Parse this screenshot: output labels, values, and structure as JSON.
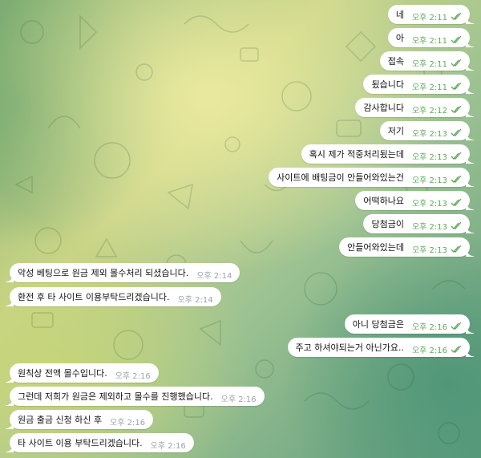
{
  "colors": {
    "incoming_bg": "#ffffff",
    "outgoing_bg": "#ffffff",
    "outgoing_time": "#5fa85a",
    "incoming_time": "#9aa4ab"
  },
  "messages": [
    {
      "dir": "out",
      "text": "네",
      "time": "오후 2:11",
      "read": true
    },
    {
      "dir": "out",
      "text": "아",
      "time": "오후 2:11",
      "read": true
    },
    {
      "dir": "out",
      "text": "접속",
      "time": "오후 2:11",
      "read": true
    },
    {
      "dir": "out",
      "text": "됬습니다",
      "time": "오후 2:11",
      "read": true
    },
    {
      "dir": "out",
      "text": "감사합니다",
      "time": "오후 2:12",
      "read": true
    },
    {
      "dir": "out",
      "text": "저기",
      "time": "오후 2:13",
      "read": true
    },
    {
      "dir": "out",
      "text": "혹시 제가 적중처리됬는데",
      "time": "오후 2:13",
      "read": true
    },
    {
      "dir": "out",
      "text": "사이트에 배팅금이 안들어와있는건",
      "time": "오후 2:13",
      "read": true
    },
    {
      "dir": "out",
      "text": "어떡하나요",
      "time": "오후 2:13",
      "read": true
    },
    {
      "dir": "out",
      "text": "당첨금이",
      "time": "오후 2:13",
      "read": true
    },
    {
      "dir": "out",
      "text": "안들어와있는데",
      "time": "오후 2:13",
      "read": true
    },
    {
      "dir": "in",
      "text": "악성 베팅으로 원금 제외 몰수처리 되셨습니다.",
      "time": "오후 2:14"
    },
    {
      "dir": "in",
      "text": "환전 후 타 사이트 이용부탁드리겠습니다.",
      "time": "오후 2:14"
    },
    {
      "dir": "out",
      "text": "아니 당첨금은",
      "time": "오후 2:16",
      "read": true
    },
    {
      "dir": "out",
      "text": "주고 하셔야되는거 아닌가요..",
      "time": "오후 2:16",
      "read": true
    },
    {
      "dir": "in",
      "text": "원칙상 전액 몰수입니다.",
      "time": "오후 2:16"
    },
    {
      "dir": "in",
      "text": "그런데 저희가 원금은 제외하고 몰수를 진행했습니다.",
      "time": "오후 2:16"
    },
    {
      "dir": "in",
      "text": "원금 출금 신청 하신 후",
      "time": "오후 2:16"
    },
    {
      "dir": "in",
      "text": "타 사이트 이용 부탁드리겠습니다.",
      "time": "오후 2:16"
    }
  ]
}
